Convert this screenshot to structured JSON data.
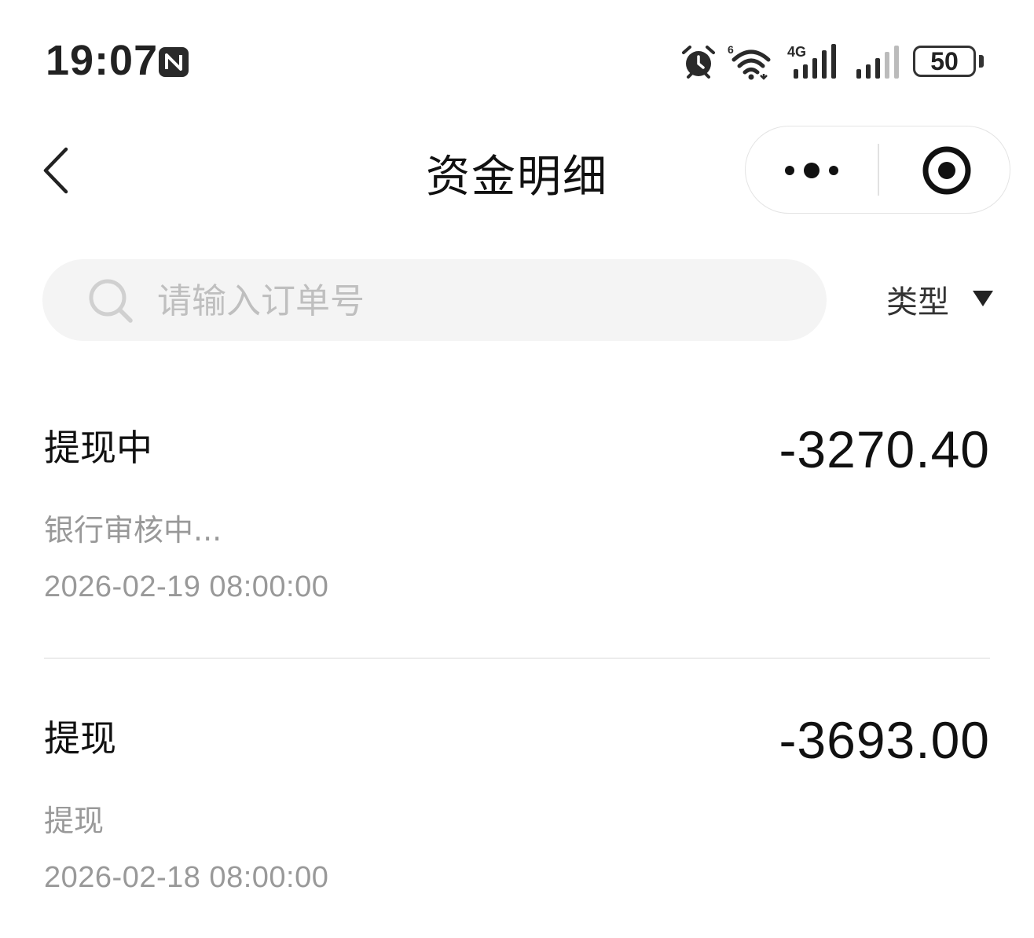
{
  "status_bar": {
    "time": "19:07",
    "battery": "50",
    "icons": [
      "nfc-icon",
      "alarm-icon",
      "wifi-icon",
      "cellular-4g-icon",
      "cellular-signal-icon",
      "battery-icon"
    ]
  },
  "nav": {
    "title": "资金明细",
    "icons": [
      "back-icon",
      "more-icon",
      "close-miniprogram-icon"
    ]
  },
  "search": {
    "placeholder": "请输入订单号",
    "value": "",
    "filter_label": "类型",
    "icons": [
      "search-icon",
      "triangle-down-icon"
    ]
  },
  "records": [
    {
      "title": "提现中",
      "amount": "-3270.40",
      "description": "银行审核中...",
      "datetime": "2026-02-19 08:00:00"
    },
    {
      "title": "提现",
      "amount": "-3693.00",
      "description": "提现",
      "datetime": "2026-02-18 08:00:00"
    }
  ]
}
